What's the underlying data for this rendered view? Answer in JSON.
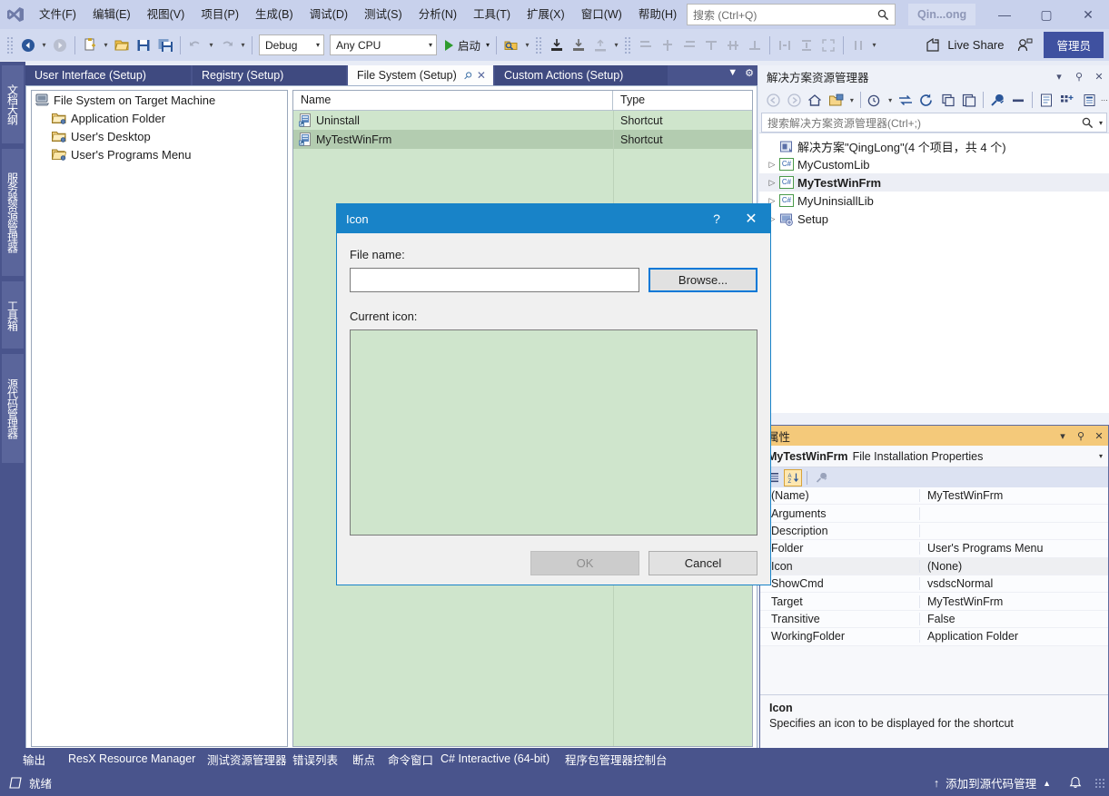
{
  "titlebar": {
    "menus": [
      "文件(F)",
      "编辑(E)",
      "视图(V)",
      "项目(P)",
      "生成(B)",
      "调试(D)",
      "测试(S)",
      "分析(N)",
      "工具(T)",
      "扩展(X)",
      "窗口(W)",
      "帮助(H)"
    ],
    "search_placeholder": "搜索 (Ctrl+Q)",
    "account": "Qin...ong",
    "minimize": "—",
    "maximize": "▢",
    "close": "✕"
  },
  "toolbar": {
    "config": "Debug",
    "platform": "Any CPU",
    "run_label": "启动",
    "live_share": "Live Share",
    "admin": "管理员"
  },
  "left_strip": {
    "tabs": [
      "文档大纲",
      "服务器资源管理器",
      "工具箱",
      "源代码管理器"
    ]
  },
  "editor_tabs": [
    {
      "label": "User Interface (Setup)",
      "active": false
    },
    {
      "label": "Registry (Setup)",
      "active": false
    },
    {
      "label": "File System (Setup)",
      "active": true
    },
    {
      "label": "Custom Actions (Setup)",
      "active": false
    }
  ],
  "file_system": {
    "tree": [
      {
        "label": "File System on Target Machine",
        "icon": "computer-icon",
        "indent": 0
      },
      {
        "label": "Application Folder",
        "icon": "folder-icon",
        "indent": 1
      },
      {
        "label": "User's Desktop",
        "icon": "folder-icon",
        "indent": 1
      },
      {
        "label": "User's Programs Menu",
        "icon": "folder-open-icon",
        "indent": 1
      }
    ],
    "columns": [
      "Name",
      "Type"
    ],
    "rows": [
      {
        "name": "Uninstall",
        "type": "Shortcut",
        "selected": false
      },
      {
        "name": "MyTestWinFrm",
        "type": "Shortcut",
        "selected": true
      }
    ]
  },
  "dialog": {
    "title": "Icon",
    "help_glyph": "?",
    "close_glyph": "✕",
    "file_name_label": "File name:",
    "file_name_value": "",
    "file_name_placeholder": "",
    "browse_label": "Browse...",
    "current_icon_label": "Current icon:",
    "ok_label": "OK",
    "cancel_label": "Cancel"
  },
  "solution_explorer": {
    "title": "解决方案资源管理器",
    "search_placeholder": "搜索解决方案资源管理器(Ctrl+;)",
    "rows": [
      {
        "label": "解决方案\"QingLong\"(4 个项目，共 4 个)",
        "icon": "solution-icon",
        "expander": "",
        "bold": false,
        "selected": false
      },
      {
        "label": "MyCustomLib",
        "icon": "csharp-project-icon",
        "expander": "▷",
        "bold": false,
        "selected": false
      },
      {
        "label": "MyTestWinFrm",
        "icon": "csharp-project-icon",
        "expander": "▷",
        "bold": true,
        "selected": true
      },
      {
        "label": "MyUninsiallLib",
        "icon": "csharp-project-icon",
        "expander": "▷",
        "bold": false,
        "selected": false
      },
      {
        "label": "Setup",
        "icon": "setup-project-icon",
        "expander": "▷",
        "bold": false,
        "selected": false
      }
    ]
  },
  "properties": {
    "title": "属性",
    "object_name": "MyTestWinFrm",
    "object_type": "File Installation Properties",
    "rows": [
      {
        "key": "(Name)",
        "value": "MyTestWinFrm",
        "selected": false
      },
      {
        "key": "Arguments",
        "value": "",
        "selected": false
      },
      {
        "key": "Description",
        "value": "",
        "selected": false
      },
      {
        "key": "Folder",
        "value": "User's Programs Menu",
        "selected": false
      },
      {
        "key": "Icon",
        "value": "(None)",
        "selected": true
      },
      {
        "key": "ShowCmd",
        "value": "vsdscNormal",
        "selected": false
      },
      {
        "key": "Target",
        "value": "MyTestWinFrm",
        "selected": false
      },
      {
        "key": "Transitive",
        "value": "False",
        "selected": false
      },
      {
        "key": "WorkingFolder",
        "value": "Application Folder",
        "selected": false
      }
    ],
    "description_title": "Icon",
    "description_text": "Specifies an icon to be displayed for the shortcut"
  },
  "bottom_tabs": [
    "输出",
    "ResX Resource Manager",
    "测试资源管理器",
    "错误列表",
    "断点",
    "命令窗口",
    "C# Interactive (64-bit)",
    "程序包管理器控制台"
  ],
  "status_bar": {
    "ready": "就绪",
    "source_control": "添加到源代码管理",
    "caret_up": "▲",
    "arrow_up": "↑",
    "bell": "🔔"
  },
  "colors": {
    "title_bg": "#c8d1ec",
    "toolbar_bg": "#d2daf0",
    "chrome_blue": "#49548c",
    "dialog_accent": "#1883c8",
    "dialog_button_focus": "#0078d7",
    "selection_green": "#b3ccb0",
    "panel_green": "#cfe5cc",
    "properties_title": "#f4c97a",
    "admin_badge": "#3f51a0"
  }
}
